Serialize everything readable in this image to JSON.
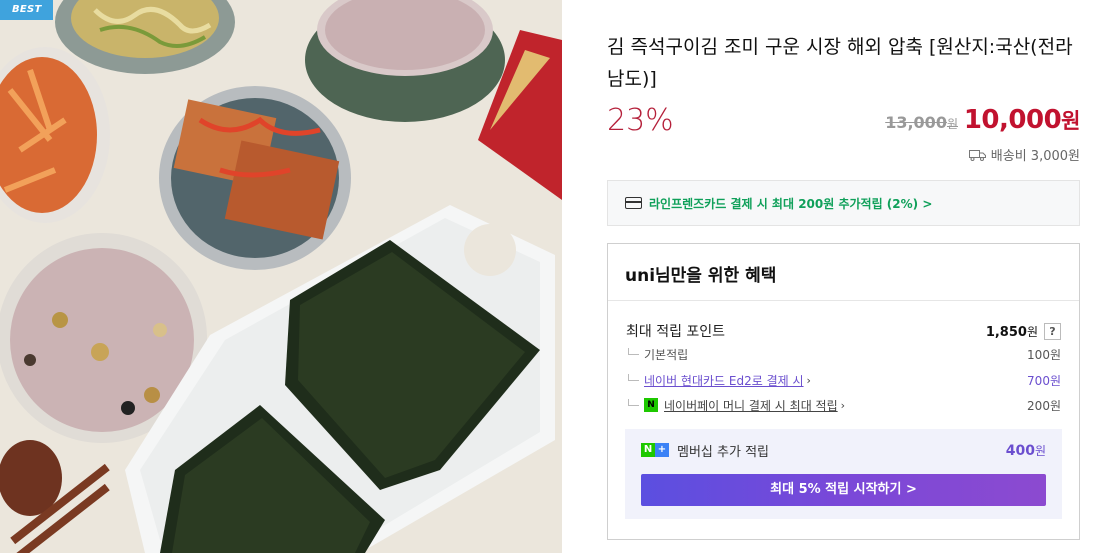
{
  "badge": {
    "label": "BEST"
  },
  "product": {
    "title": "김 즉석구이김 조미 구운 시장 해외 압축 [원산지:국산(전라남도)]",
    "discount": "23%",
    "original_price": "13,000",
    "original_unit": "원",
    "sale_price": "10,000",
    "sale_unit": "원",
    "shipping": "배송비 3,000원"
  },
  "card_promo": {
    "icon": "credit-card-icon",
    "text": "라인프렌즈카드 결제 시 최대 200원 추가적립 (2%) >"
  },
  "benefit": {
    "title": "uni님만을 위한 혜택",
    "max_points_label": "최대 적립 포인트",
    "max_points_value": "1,850",
    "max_points_unit": "원",
    "help_label": "?",
    "rows": [
      {
        "label": "기본적립",
        "value": "100원"
      },
      {
        "label": "네이버 현대카드 Ed2로 결제 시",
        "value": "700원"
      },
      {
        "label": "네이버페이 머니 결제 시 최대 적립",
        "value": "200원"
      }
    ],
    "npay_icon_label": "N",
    "membership": {
      "icon_n": "N",
      "icon_plus": "+",
      "label": "멤버십 추가 적립",
      "value": "400",
      "unit": "원",
      "cta": "최대 5% 적립 시작하기 >"
    }
  },
  "colors": {
    "discount": "#b5203a",
    "sale_price": "#c1122f",
    "promo_green": "#10a05a",
    "purple": "#6b4fcf",
    "badge_blue": "#3fa3dd"
  }
}
